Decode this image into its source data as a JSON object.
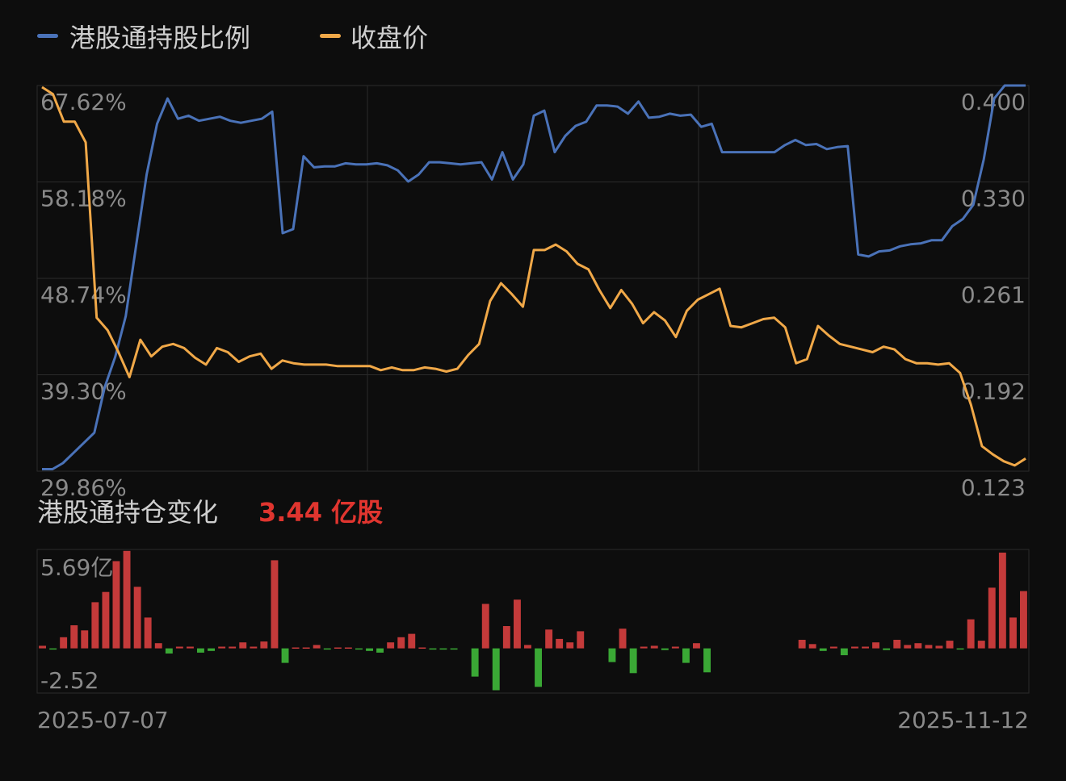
{
  "legend": {
    "items": [
      {
        "label": "港股通持股比例",
        "color": "#4a72b8"
      },
      {
        "label": "收盘价",
        "color": "#f0a848"
      }
    ]
  },
  "section2": {
    "title": "港股通持仓变化",
    "value": "3.44 亿股",
    "value_color": "#e0352f"
  },
  "colors": {
    "background": "#0d0d0d",
    "grid": "#2a2a2a",
    "axis_text": "#8a8a8a",
    "bar_positive": "#c43a3a",
    "bar_negative": "#3aa835"
  },
  "chart_data": [
    {
      "type": "line",
      "title": "",
      "date_start": "2025-07-07",
      "date_end": "2025-11-12",
      "left_axis": {
        "ticks": [
          "67.62%",
          "58.18%",
          "48.74%",
          "39.30%",
          "29.86%"
        ],
        "ylim": [
          29.86,
          67.62
        ]
      },
      "right_axis": {
        "ticks": [
          "0.400",
          "0.330",
          "0.261",
          "0.192",
          "0.123"
        ],
        "ylim": [
          0.123,
          0.4
        ]
      },
      "series": [
        {
          "name": "港股通持股比例",
          "axis": "left",
          "values": [
            29.9,
            29.9,
            30.5,
            31.5,
            32.5,
            33.5,
            38,
            41,
            45,
            52,
            59,
            64,
            66.5,
            64.5,
            64.8,
            64.3,
            64.5,
            64.7,
            64.3,
            64.1,
            64.3,
            64.5,
            65.2,
            53.2,
            53.6,
            60.8,
            59.7,
            59.8,
            59.8,
            60.1,
            60.0,
            60.0,
            60.1,
            59.9,
            59.4,
            58.3,
            59.0,
            60.2,
            60.2,
            60.1,
            60.0,
            60.1,
            60.2,
            58.5,
            61.2,
            58.5,
            60.0,
            64.8,
            65.3,
            61.2,
            62.8,
            63.8,
            64.2,
            65.8,
            65.8,
            65.7,
            65.0,
            66.2,
            64.6,
            64.7,
            65.0,
            64.8,
            64.9,
            63.7,
            64.0,
            61.2,
            61.2,
            61.2,
            61.2,
            61.2,
            61.2,
            61.9,
            62.4,
            61.9,
            62.0,
            61.5,
            61.7,
            61.8,
            51.1,
            50.9,
            51.4,
            51.5,
            51.9,
            52.1,
            52.2,
            52.5,
            52.5,
            53.9,
            54.6,
            56.0,
            60.5,
            66.5,
            68.0,
            69.0,
            70.0
          ]
        },
        {
          "name": "收盘价",
          "axis": "right",
          "values": [
            0.4,
            0.395,
            0.375,
            0.375,
            0.36,
            0.233,
            0.224,
            0.208,
            0.19,
            0.217,
            0.205,
            0.212,
            0.214,
            0.211,
            0.204,
            0.199,
            0.211,
            0.208,
            0.201,
            0.205,
            0.207,
            0.196,
            0.202,
            0.2,
            0.199,
            0.199,
            0.199,
            0.198,
            0.198,
            0.198,
            0.198,
            0.195,
            0.197,
            0.195,
            0.195,
            0.197,
            0.196,
            0.194,
            0.196,
            0.206,
            0.214,
            0.245,
            0.258,
            0.25,
            0.241,
            0.282,
            0.282,
            0.286,
            0.281,
            0.272,
            0.268,
            0.253,
            0.24,
            0.253,
            0.243,
            0.229,
            0.237,
            0.231,
            0.219,
            0.238,
            0.246,
            0.25,
            0.254,
            0.227,
            0.226,
            0.229,
            0.232,
            0.233,
            0.226,
            0.2,
            0.203,
            0.227,
            0.22,
            0.214,
            0.212,
            0.21,
            0.208,
            0.212,
            0.21,
            0.203,
            0.2,
            0.2,
            0.199,
            0.2,
            0.193,
            0.17,
            0.14,
            0.134,
            0.129,
            0.126,
            0.131
          ]
        }
      ]
    },
    {
      "type": "bar",
      "title": "港股通持仓变化",
      "unit": "亿股",
      "ylim": [
        -2.52,
        5.69
      ],
      "ticks": [
        "5.69亿",
        "-2.52"
      ],
      "values": [
        0.15,
        -0.05,
        0.65,
        1.35,
        1.05,
        2.7,
        3.3,
        5.1,
        5.7,
        3.6,
        1.8,
        0.3,
        -0.3,
        0.1,
        0.1,
        -0.25,
        -0.15,
        0.1,
        0.1,
        0.35,
        0.1,
        0.4,
        5.15,
        -0.85,
        0.05,
        0.05,
        0.2,
        -0.05,
        0.05,
        0.05,
        -0.05,
        -0.15,
        -0.25,
        0.35,
        0.65,
        0.85,
        0.05,
        -0.05,
        -0.05,
        -0.05,
        0.0,
        -1.65,
        2.6,
        -2.45,
        1.3,
        2.85,
        0.2,
        -2.25,
        1.1,
        0.55,
        0.35,
        1.0,
        0.0,
        0.0,
        -0.8,
        1.15,
        -1.45,
        0.1,
        0.15,
        -0.1,
        0.1,
        -0.85,
        0.3,
        -1.4,
        0.0,
        0.0,
        0.0,
        0.0,
        0.0,
        0.0,
        0.0,
        0.0,
        0.5,
        0.25,
        -0.15,
        0.1,
        -0.4,
        0.1,
        0.1,
        0.35,
        -0.1,
        0.5,
        0.2,
        0.3,
        0.2,
        0.15,
        0.45,
        -0.05,
        1.7,
        0.45,
        3.55,
        5.6,
        1.8,
        3.35
      ]
    }
  ]
}
